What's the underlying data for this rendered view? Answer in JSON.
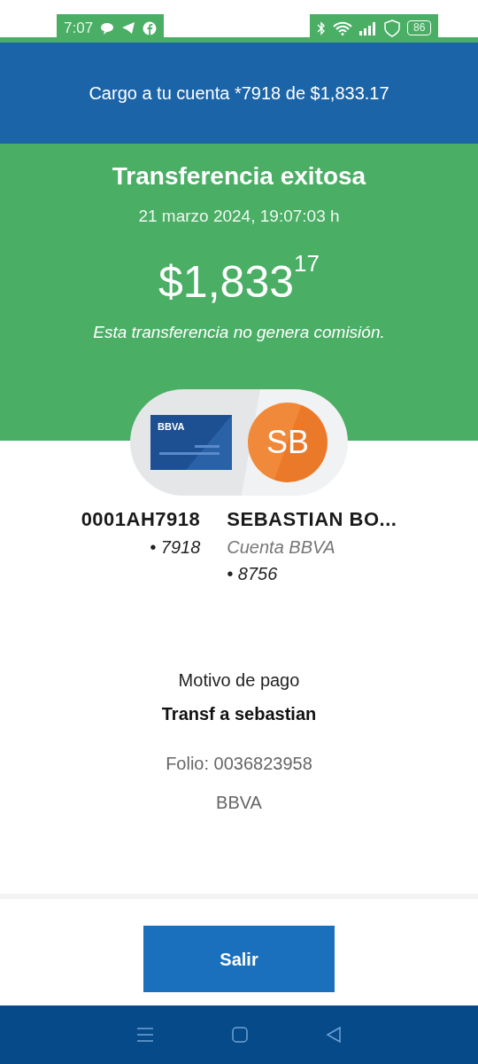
{
  "status_bar": {
    "time": "7:07",
    "battery": "86"
  },
  "header": {
    "title": "Cargo a tu cuenta *7918 de $1,833.17"
  },
  "result": {
    "title": "Transferencia exitosa",
    "date": "21 marzo 2024, 19:07:03 h",
    "amount": "$1,833",
    "cents": "17",
    "note": "Esta transferencia no genera comisión."
  },
  "card_logo": "BBVA",
  "recipient_initials": "SB",
  "origin": {
    "name": "0001AH7918",
    "account": "• 7918"
  },
  "destination": {
    "name": "SEBASTIAN BO...",
    "bank": "Cuenta BBVA",
    "account": "• 8756"
  },
  "details": [
    {
      "kind": "label",
      "text": "Motivo de pago"
    },
    {
      "kind": "value",
      "text": "Transf a sebastian"
    },
    {
      "kind": "muted",
      "text": "Folio: 0036823958"
    },
    {
      "kind": "muted",
      "text": "BBVA"
    }
  ],
  "button": "Salir"
}
